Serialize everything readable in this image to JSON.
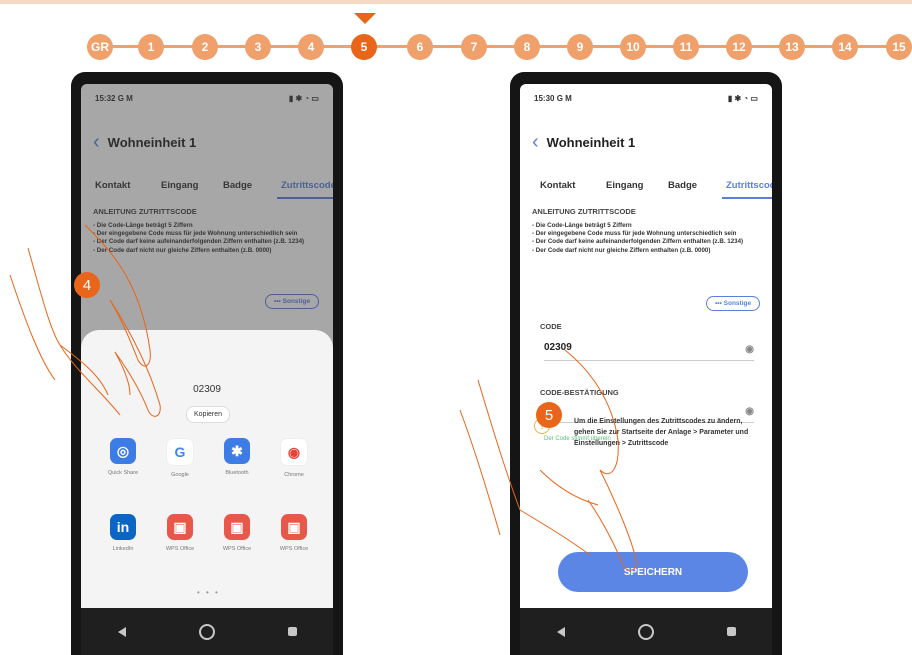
{
  "steps": [
    "GR",
    "1",
    "2",
    "3",
    "4",
    "5",
    "6",
    "7",
    "8",
    "9",
    "10",
    "11",
    "12",
    "13",
    "14",
    "15"
  ],
  "active_step": "5",
  "colors": {
    "accent": "#e8651a",
    "step": "#f0a06b",
    "link": "#5b7fe0",
    "button": "#5b86e5",
    "success": "#5bbf7a"
  },
  "left": {
    "time": "15:32",
    "status_letters": "G M",
    "title": "Wohneinheit 1",
    "tabs": [
      "Kontakt",
      "Eingang",
      "Badge",
      "Zutrittscode"
    ],
    "instr_heading": "ANLEITUNG ZUTRITTSCODE",
    "instr_lines": [
      "- Die Code-Länge beträgt 5 Ziffern",
      "- Der eingegebene Code muss für jede Wohnung unterschiedlich sein",
      "- Der Code darf keine aufeinanderfolgenden Ziffern enthalten (z.B. 1234)",
      "- Der Code darf nicht nur gleiche Ziffern enthalten (z.B. 0000)"
    ],
    "sonstige": "Sonstige",
    "sheet_code": "02309",
    "kopieren": "Kopieren",
    "apps": [
      {
        "name": "Quick Share",
        "icon": "quick-share-icon",
        "color": "#3d7be5"
      },
      {
        "name": "Google",
        "icon": "google-icon",
        "color": "#ffffff"
      },
      {
        "name": "Bluetooth",
        "icon": "bluetooth-icon",
        "color": "#3d7be5"
      },
      {
        "name": "Chrome",
        "icon": "chrome-icon",
        "color": "#ffffff"
      },
      {
        "name": "LinkedIn",
        "icon": "linkedin-icon",
        "color": "#0a66c2"
      },
      {
        "name": "WPS Office",
        "icon": "wps-icon",
        "color": "#e8584a"
      },
      {
        "name": "WPS Office",
        "icon": "wps-icon",
        "color": "#e8584a"
      },
      {
        "name": "WPS Office",
        "icon": "wps-icon",
        "color": "#e8584a"
      }
    ],
    "pager": "• • •",
    "callout": "4"
  },
  "right": {
    "time": "15:30",
    "status_letters": "G M",
    "title": "Wohneinheit 1",
    "tabs": [
      "Kontakt",
      "Eingang",
      "Badge",
      "Zutrittscode"
    ],
    "instr_heading": "ANLEITUNG ZUTRITTSCODE",
    "instr_lines": [
      "- Die Code-Länge beträgt 5 Ziffern",
      "- Der eingegebene Code muss für jede Wohnung unterschiedlich sein",
      "- Der Code darf keine aufeinanderfolgenden Ziffern enthalten (z.B. 1234)",
      "- Der Code darf nicht nur gleiche Ziffern enthalten (z.B. 0000)"
    ],
    "sonstige": "Sonstige",
    "code_label": "CODE",
    "code_value": "02309",
    "confirm_label": "CODE-BESTÄTIGUNG",
    "match_text": "Der Code stimmt überein",
    "info_text": "Um die Einstellungen des Zutrittscodes zu ändern, gehen Sie zur Startseite der Anlage > Parameter und Einstellungen > Zutrittscode",
    "save": "SPEICHERN",
    "callout": "5"
  }
}
